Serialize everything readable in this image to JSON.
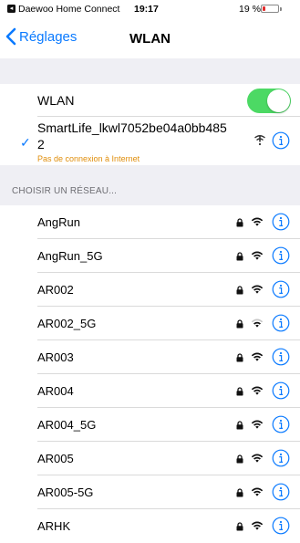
{
  "status_bar": {
    "back_glyph": "◂",
    "app_name": "Daewoo Home Connect",
    "time": "19:17",
    "battery_text": "19 %",
    "battery_level": 0.19,
    "battery_color": "#e12c2c"
  },
  "nav": {
    "back_label": "Réglages",
    "title": "WLAN",
    "accent_color": "#0a7aff"
  },
  "wlan_toggle": {
    "label": "WLAN",
    "on": true,
    "on_color": "#4cd964"
  },
  "connected": {
    "name": "SmartLife_lkwl7052be04a0bb4852",
    "status": "Pas de connexion à Internet",
    "check_glyph": "✓",
    "status_icon": "no-internet-icon",
    "info_icon": "info-icon"
  },
  "section_header": "CHOISIR UN RÉSEAU...",
  "networks": [
    {
      "name": "AngRun"
    },
    {
      "name": "AngRun_5G"
    },
    {
      "name": "AR002"
    },
    {
      "name": "AR002_5G",
      "weak": true
    },
    {
      "name": "AR003"
    },
    {
      "name": "AR004"
    },
    {
      "name": "AR004_5G"
    },
    {
      "name": "AR005"
    },
    {
      "name": "AR005-5G"
    },
    {
      "name": "ARHK"
    }
  ]
}
